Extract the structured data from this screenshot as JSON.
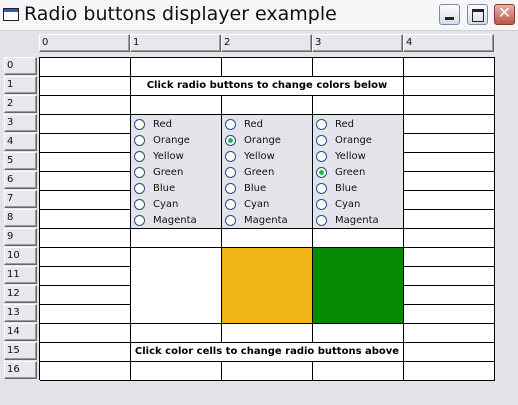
{
  "window": {
    "title": "Radio buttons displayer example",
    "close_glyph": "✕",
    "icon": "app-window-icon",
    "buttons": [
      "minimize-icon",
      "maximize-icon",
      "close-icon"
    ]
  },
  "columns": [
    "0",
    "1",
    "2",
    "3",
    "4"
  ],
  "rows": [
    "0",
    "1",
    "2",
    "3",
    "4",
    "5",
    "6",
    "7",
    "8",
    "9",
    "10",
    "11",
    "12",
    "13",
    "14",
    "15",
    "16"
  ],
  "messages": {
    "top": "Click radio buttons to change colors below",
    "bottom": "Click color cells to change radio buttons above"
  },
  "radio_options": [
    "Red",
    "Orange",
    "Yellow",
    "Green",
    "Blue",
    "Cyan",
    "Magenta"
  ],
  "radio_groups": [
    {
      "selected": null
    },
    {
      "selected": "Orange"
    },
    {
      "selected": "Green"
    }
  ],
  "swatches": [
    {
      "color": "#ffffff"
    },
    {
      "color": "#f0b514"
    },
    {
      "color": "#068a06"
    }
  ]
}
